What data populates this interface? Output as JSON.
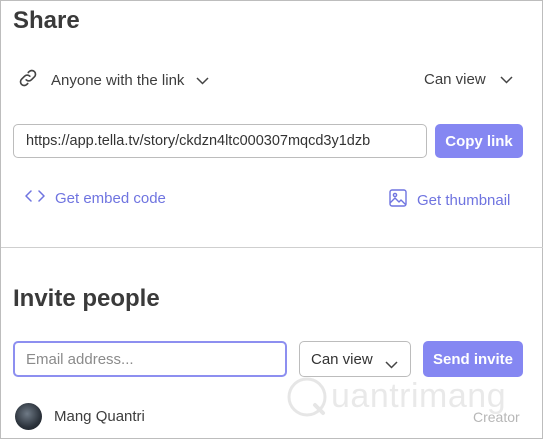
{
  "share": {
    "title": "Share",
    "access_label": "Anyone with the link",
    "permission": "Can view",
    "link_url": "https://app.tella.tv/story/ckdzn4ltc000307mqcd3y1dzb",
    "copy_label": "Copy link",
    "embed_label": "Get embed code",
    "thumbnail_label": "Get thumbnail"
  },
  "invite": {
    "title": "Invite people",
    "email_placeholder": "Email address...",
    "permission": "Can view",
    "send_label": "Send invite"
  },
  "members": [
    {
      "name": "Mang Quantri",
      "role": "Creator"
    }
  ],
  "watermark": {
    "text": "uantrimang"
  },
  "colors": {
    "accent": "#8587f2",
    "link": "#6f74e0",
    "text": "#3a3a3a"
  }
}
